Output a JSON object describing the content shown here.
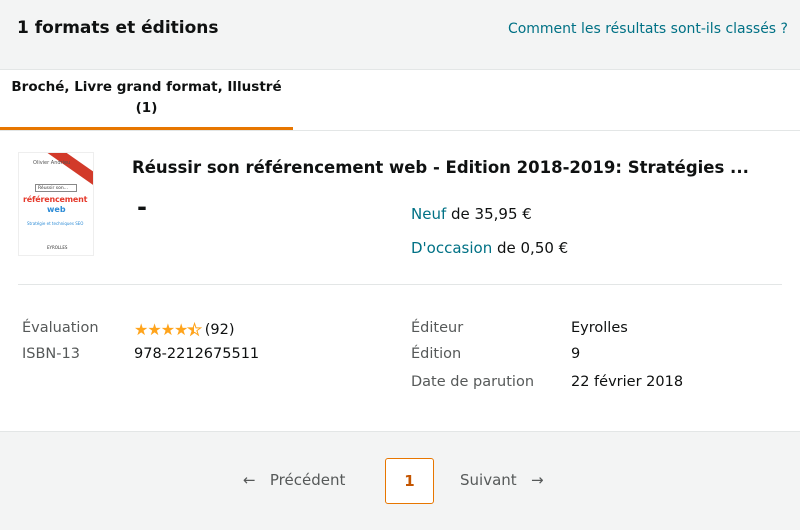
{
  "header": {
    "title": "1 formats et éditions",
    "ranking_link": "Comment les résultats sont-ils classés ?"
  },
  "tabs": [
    {
      "label": "Broché, Livre grand format, Illustré",
      "count": "(1)",
      "selected": true
    }
  ],
  "product": {
    "cover_image": {
      "author": "Olivier Andrieu",
      "search_box_text": "Réussir son...",
      "title_line1": "référencement",
      "title_line2": "web",
      "subtitle": "Stratégie et techniques SEO",
      "publisher": "EYROLLES"
    },
    "title": "Réussir son référencement web - Edition 2018-2019: Stratégies ...",
    "format_dash": "-",
    "offers": [
      {
        "link": "Neuf",
        "text": "de 35,95 €"
      },
      {
        "link": "D'occasion",
        "text": "de 0,50 €"
      }
    ],
    "details": {
      "rating_label": "Évaluation",
      "rating_stars_icon": "star-rating-icon",
      "rating_value": 4.5,
      "rating_count": "(92)",
      "isbn_label": "ISBN-13",
      "isbn_value": "978-2212675511",
      "publisher_label": "Éditeur",
      "publisher_value": "Eyrolles",
      "edition_label": "Édition",
      "edition_value": "9",
      "date_label": "Date de parution",
      "date_value": "22 février 2018"
    }
  },
  "pagination": {
    "prev_arrow": "←",
    "prev": "Précédent",
    "current": "1",
    "next": "Suivant",
    "next_arrow": "→"
  },
  "colors": {
    "link": "#007185",
    "accent": "#e77600",
    "star": "#ffa41c",
    "panel_bg": "#f3f4f4"
  }
}
